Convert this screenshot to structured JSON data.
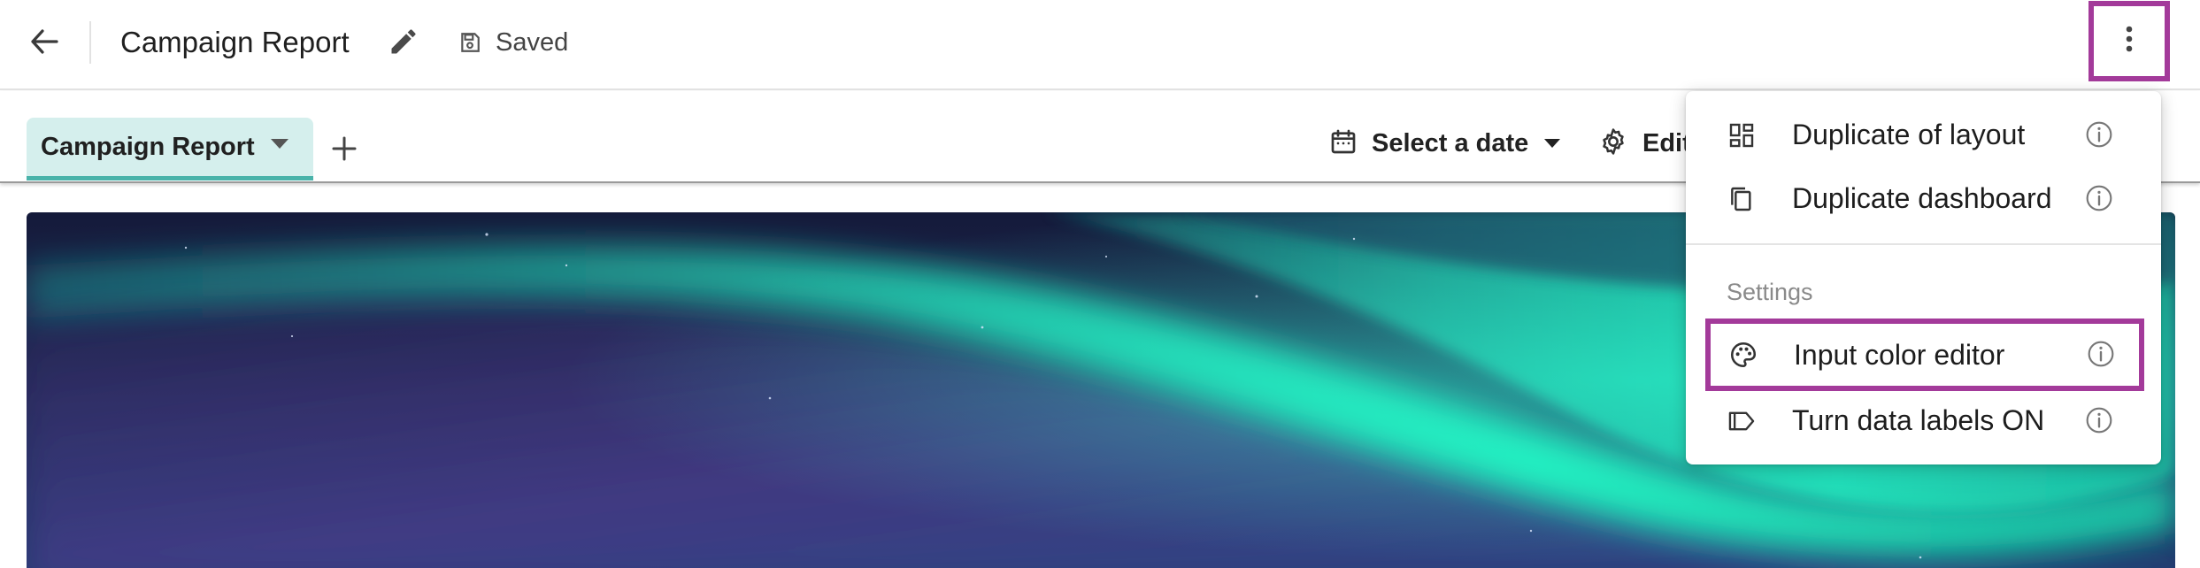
{
  "header": {
    "title": "Campaign Report",
    "save_status": "Saved"
  },
  "tabs": {
    "active_label": "Campaign Report"
  },
  "toolbar": {
    "date_label": "Select a date",
    "settings_label": "Edit"
  },
  "menu": {
    "items": [
      {
        "label": "Duplicate of layout",
        "icon": "layout-icon"
      },
      {
        "label": "Duplicate dashboard",
        "icon": "copy-icon"
      }
    ],
    "section_label": "Settings",
    "settings_items": [
      {
        "label": "Input color editor",
        "icon": "palette-icon"
      },
      {
        "label": "Turn data labels ON",
        "icon": "label-icon"
      }
    ]
  },
  "colors": {
    "highlight": "#a33a9a",
    "tab_background": "#d5efed",
    "tab_underline": "#49b3aa"
  }
}
